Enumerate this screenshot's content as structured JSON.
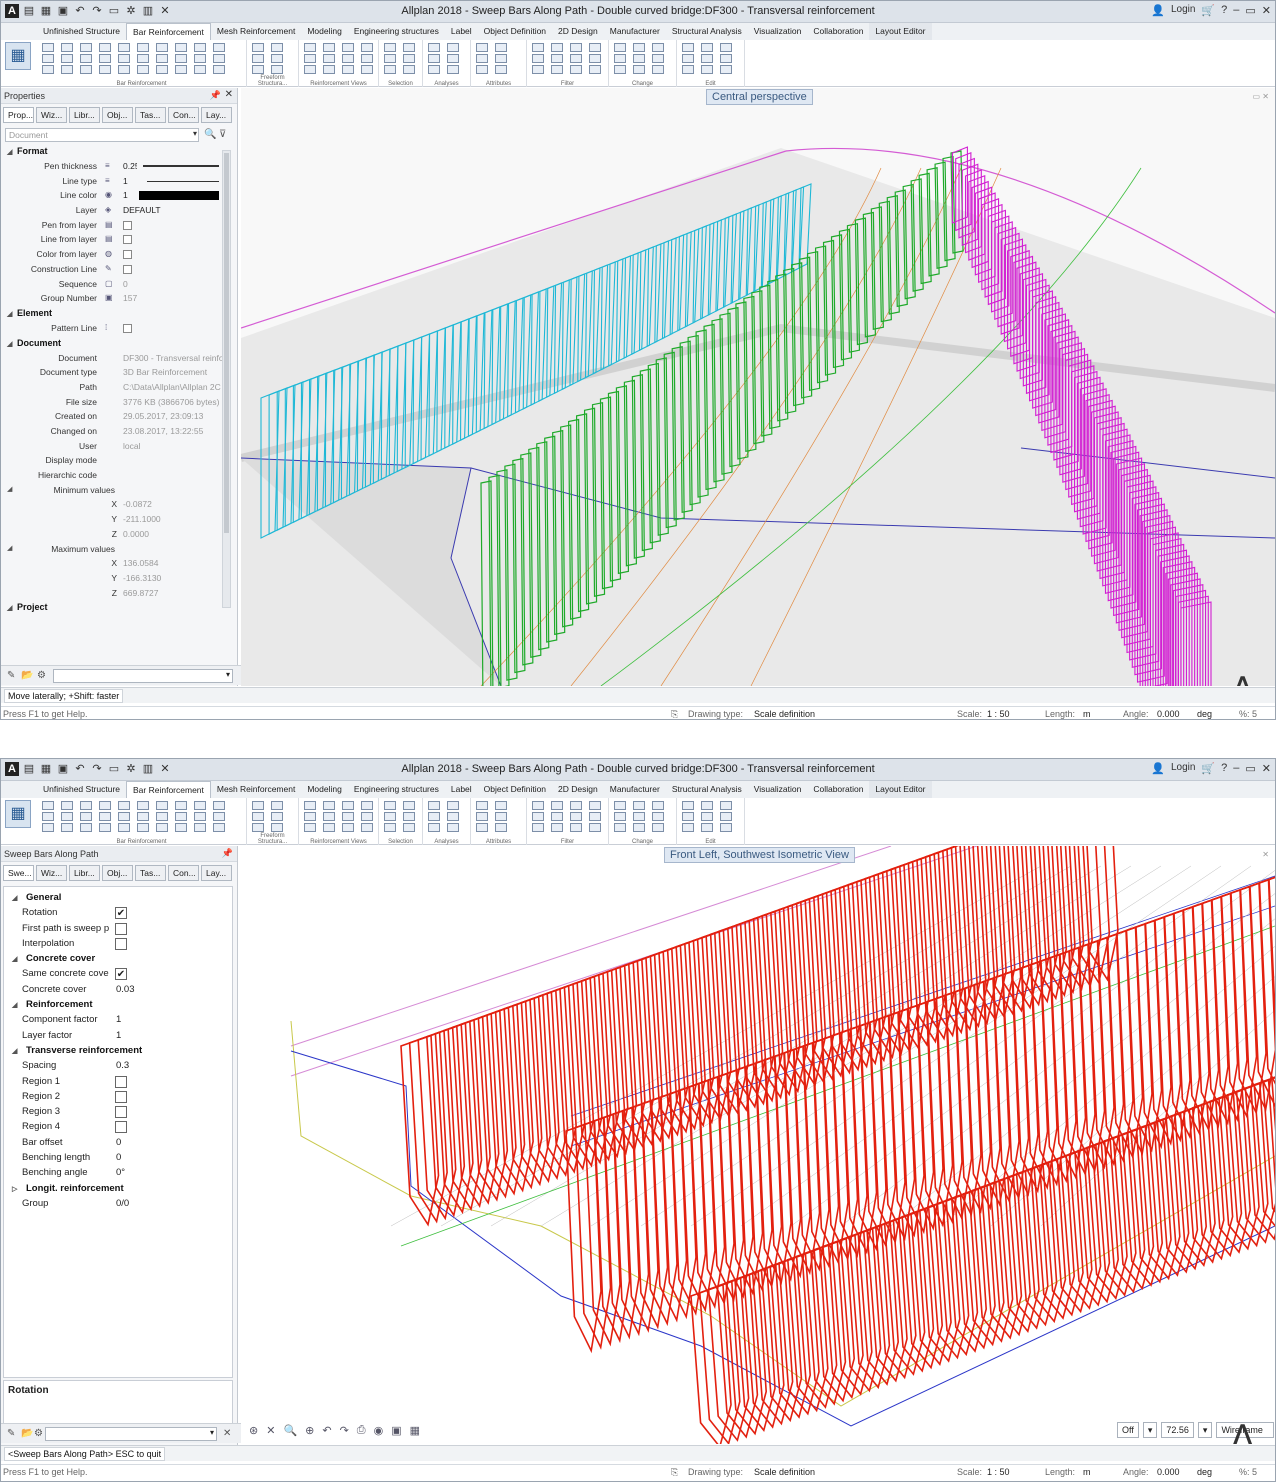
{
  "window_title": "Allplan 2018 - Sweep Bars Along Path - Double curved bridge:DF300 - Transversal reinforcement",
  "login_label": "Login",
  "ribbon_tabs": [
    "Unfinished Structure",
    "Bar Reinforcement",
    "Mesh Reinforcement",
    "Modeling",
    "Engineering structures",
    "Label",
    "Object Definition",
    "2D Design",
    "Manufacturer",
    "Structural Analysis",
    "Visualization",
    "Collaboration",
    "Layout Editor"
  ],
  "ribbon_groups": [
    "Bar Reinforcement",
    "Freeform Structura...",
    "Reinforcement Views",
    "Selection",
    "Analyses",
    "Attributes",
    "Filter",
    "Change",
    "Edit"
  ],
  "top": {
    "panel_title": "Properties",
    "panel_tabs": [
      "Prop...",
      "Wiz...",
      "Libr...",
      "Obj...",
      "Tas...",
      "Con...",
      "Lay..."
    ],
    "search_placeholder": "Document",
    "sections": {
      "format": "Format",
      "element": "Element",
      "document": "Document",
      "project": "Project"
    },
    "format_rows": [
      {
        "key": "Pen thickness",
        "value": "0.25"
      },
      {
        "key": "Line type",
        "value": "1"
      },
      {
        "key": "Line color",
        "value": "1"
      },
      {
        "key": "Layer",
        "value": "DEFAULT"
      },
      {
        "key": "Pen from layer",
        "value": ""
      },
      {
        "key": "Line from layer",
        "value": ""
      },
      {
        "key": "Color from layer",
        "value": ""
      },
      {
        "key": "Construction Line",
        "value": ""
      },
      {
        "key": "Sequence",
        "value": "0"
      },
      {
        "key": "Group Number",
        "value": "157"
      }
    ],
    "element_rows": [
      {
        "key": "Pattern Line",
        "value": ""
      }
    ],
    "document_rows": [
      {
        "key": "Document",
        "value": "DF300 - Transversal reinfo"
      },
      {
        "key": "Document type",
        "value": "3D Bar Reinforcement"
      },
      {
        "key": "Path",
        "value": "C:\\Data\\Allplan\\Allplan 2C"
      },
      {
        "key": "File size",
        "value": "3776 KB (3866706 bytes)"
      },
      {
        "key": "Created on",
        "value": "29.05.2017, 23:09:13"
      },
      {
        "key": "Changed on",
        "value": "23.08.2017, 13:22:55"
      },
      {
        "key": "User",
        "value": "local"
      },
      {
        "key": "Display mode",
        "value": ""
      },
      {
        "key": "Hierarchic code",
        "value": ""
      }
    ],
    "min_label": "Minimum values",
    "min_values": [
      {
        "key": "X",
        "value": "-0.0872"
      },
      {
        "key": "Y",
        "value": "-211.1000"
      },
      {
        "key": "Z",
        "value": "0.0000"
      }
    ],
    "max_label": "Maximum values",
    "max_values": [
      {
        "key": "X",
        "value": "136.0584"
      },
      {
        "key": "Y",
        "value": "-166.3130"
      },
      {
        "key": "Z",
        "value": "669.8727"
      }
    ],
    "view_label": "Central perspective",
    "prompt": "Move laterally; +Shift: faster",
    "help": "Press F1 to get Help."
  },
  "bottom": {
    "panel_title": "Sweep Bars Along Path",
    "panel_tabs": [
      "Swe...",
      "Wiz...",
      "Libr...",
      "Obj...",
      "Tas...",
      "Con...",
      "Lay..."
    ],
    "groups": [
      {
        "title": "General",
        "rows": [
          {
            "key": "Rotation",
            "type": "check",
            "checked": true
          },
          {
            "key": "First path is sweep p",
            "type": "check",
            "checked": false
          },
          {
            "key": "Interpolation",
            "type": "check",
            "checked": false
          }
        ]
      },
      {
        "title": "Concrete cover",
        "rows": [
          {
            "key": "Same concrete cove",
            "type": "check",
            "checked": true
          },
          {
            "key": "Concrete cover",
            "type": "text",
            "value": "0.03"
          }
        ]
      },
      {
        "title": "Reinforcement",
        "rows": [
          {
            "key": "Component factor",
            "type": "text",
            "value": "1"
          },
          {
            "key": "Layer factor",
            "type": "text",
            "value": "1"
          }
        ]
      },
      {
        "title": "Transverse reinforcement",
        "rows": [
          {
            "key": "Spacing",
            "type": "text",
            "value": "0.3"
          },
          {
            "key": "Region 1",
            "type": "check",
            "checked": false
          },
          {
            "key": "Region 2",
            "type": "check",
            "checked": false
          },
          {
            "key": "Region 3",
            "type": "check",
            "checked": false
          },
          {
            "key": "Region 4",
            "type": "check",
            "checked": false
          },
          {
            "key": "Bar offset",
            "type": "text",
            "value": "0"
          },
          {
            "key": "Benching length",
            "type": "text",
            "value": "0"
          },
          {
            "key": "Benching angle",
            "type": "text",
            "value": "0°"
          }
        ]
      },
      {
        "title": "Longit. reinforcement",
        "rows": [
          {
            "key": "Group",
            "type": "text",
            "value": "0/0"
          }
        ]
      }
    ],
    "description_title": "Rotation",
    "view_label": "Front Left, Southwest Isometric View",
    "prompt": "<Sweep Bars Along Path> ESC to quit",
    "help": "Press F1 to get Help.",
    "viewport_controls": {
      "off": "Off",
      "zoom": "72.56",
      "mode": "Wireframe"
    }
  },
  "status": {
    "drawing_type_label": "Drawing type:",
    "drawing_type": "Scale definition",
    "scale_label": "Scale:",
    "scale": "1 : 50",
    "length_label": "Length:",
    "length": "m",
    "angle_label": "Angle:",
    "angle": "0.000",
    "angle_unit": "deg",
    "percent": "%: 5"
  },
  "colors": {
    "cyan": "#1fb8d6",
    "green": "#1faa2a",
    "magenta": "#d21ed2",
    "red": "#e3200f",
    "blue": "#2b36c8"
  },
  "icons": [
    "app-logo-icon",
    "save-icon",
    "undo-icon",
    "redo-icon",
    "settings-icon",
    "cart-icon",
    "help-icon",
    "pin-icon",
    "close-icon",
    "search-icon",
    "filter-icon",
    "arrow-icon"
  ]
}
